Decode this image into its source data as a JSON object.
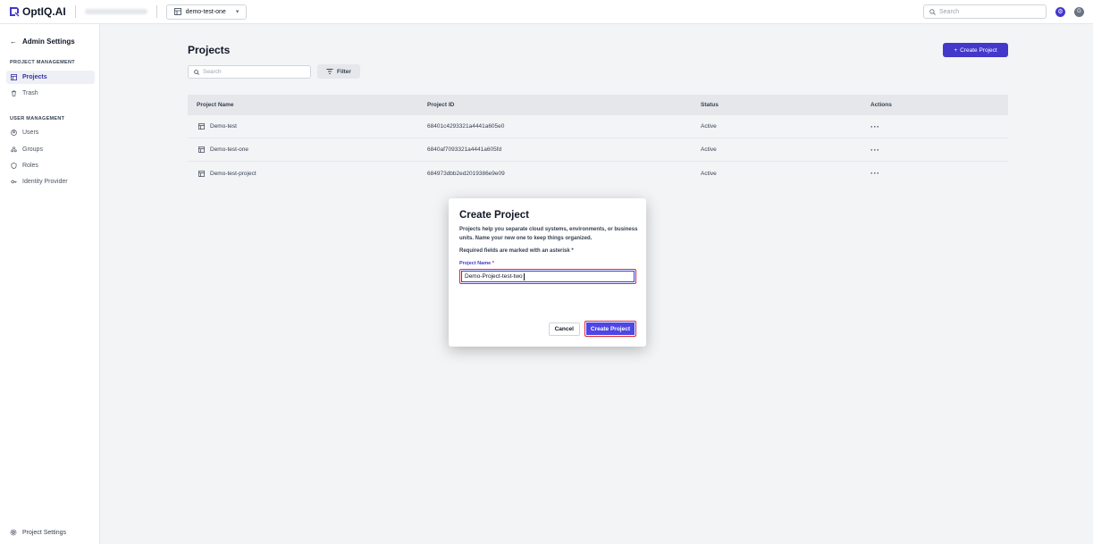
{
  "app": {
    "logo_text": "OptIQ.AI"
  },
  "topbar": {
    "project_selector": "demo-test-one",
    "search_placeholder": "Search",
    "avatar_initial": "G"
  },
  "sidebar": {
    "back_label": "Admin Settings",
    "project_section": "PROJECT MANAGEMENT",
    "project_items": [
      {
        "label": "Projects",
        "icon": "grid-icon"
      },
      {
        "label": "Trash",
        "icon": "trash-icon"
      }
    ],
    "user_section": "USER MANAGEMENT",
    "user_items": [
      {
        "label": "Users",
        "icon": "user-icon"
      },
      {
        "label": "Groups",
        "icon": "groups-icon"
      },
      {
        "label": "Roles",
        "icon": "shield-icon"
      },
      {
        "label": "Identity Provider",
        "icon": "key-icon"
      }
    ],
    "footer_label": "Project Settings"
  },
  "main": {
    "title": "Projects",
    "create_button": "Create Project",
    "search_placeholder": "Search",
    "filter_label": "Filter",
    "columns": [
      "Project Name",
      "Project ID",
      "Status",
      "Actions"
    ],
    "rows": [
      {
        "name": "Demo-test",
        "id": "68401c4293321a4441a605e0",
        "status": "Active",
        "actions": "···"
      },
      {
        "name": "Demo-test-one",
        "id": "6840af7093321a4441a605fd",
        "status": "Active",
        "actions": "···"
      },
      {
        "name": "Demo-test-project",
        "id": "684973dbb2ed2019386e9e09",
        "status": "Active",
        "actions": "···"
      }
    ]
  },
  "modal": {
    "title": "Create Project",
    "description": "Projects help you separate cloud systems, environments, or business units. Name your new one to keep things organized.",
    "required_note": "Required fields are marked with an asterisk *",
    "field_label": "Project Name",
    "field_required": "*",
    "field_value": "Demo-Project-test-two",
    "cancel_label": "Cancel",
    "submit_label": "Create Project"
  },
  "colors": {
    "accent": "#4338ca",
    "highlight": "#dc2626"
  }
}
